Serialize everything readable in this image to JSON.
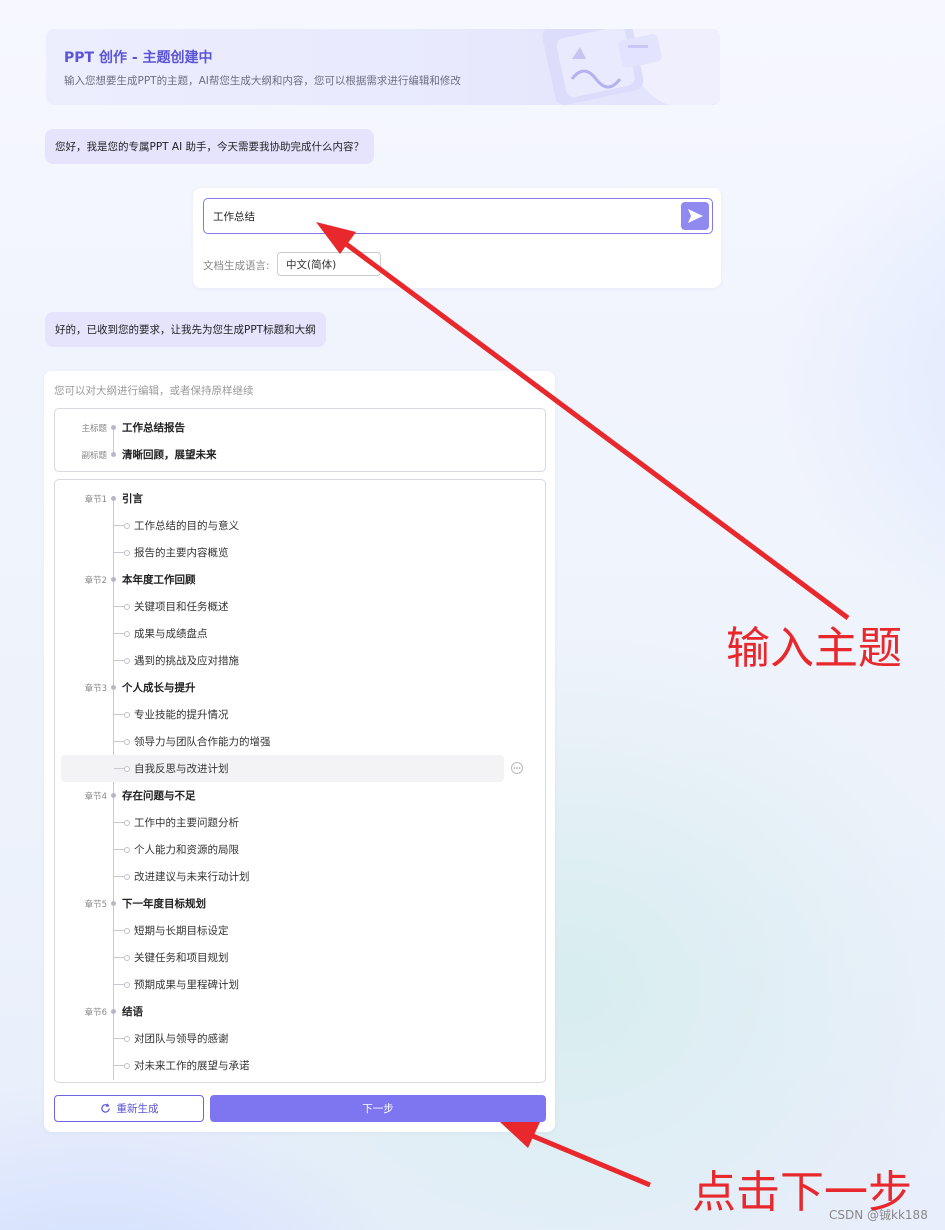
{
  "header": {
    "title": "PPT 创作 - 主题创建中",
    "subtitle": "输入您想要生成PPT的主题，AI帮您生成大纲和内容，您可以根据需求进行编辑和修改"
  },
  "chat": {
    "greeting": "您好，我是您的专属PPT AI 助手，今天需要我协助完成什么内容？",
    "ack": "好的，已收到您的要求，让我先为您生成PPT标题和大纲"
  },
  "input": {
    "topic_value": "工作总结",
    "language_label": "文档生成语言:",
    "language_value": "中文(简体)"
  },
  "outline": {
    "hint": "您可以对大纲进行编辑，或者保持原样继续",
    "main_title_tag": "主标题",
    "main_title": "工作总结报告",
    "subtitle_tag": "副标题",
    "subtitle": "清晰回顾，展望未来",
    "chapters": [
      {
        "tag": "章节1",
        "title": "引言",
        "items": [
          "工作总结的目的与意义",
          "报告的主要内容概览"
        ]
      },
      {
        "tag": "章节2",
        "title": "本年度工作回顾",
        "items": [
          "关键项目和任务概述",
          "成果与成绩盘点",
          "遇到的挑战及应对措施"
        ]
      },
      {
        "tag": "章节3",
        "title": "个人成长与提升",
        "items": [
          "专业技能的提升情况",
          "领导力与团队合作能力的增强",
          "自我反思与改进计划"
        ]
      },
      {
        "tag": "章节4",
        "title": "存在问题与不足",
        "items": [
          "工作中的主要问题分析",
          "个人能力和资源的局限",
          "改进建议与未来行动计划"
        ]
      },
      {
        "tag": "章节5",
        "title": "下一年度目标规划",
        "items": [
          "短期与长期目标设定",
          "关键任务和项目规划",
          "预期成果与里程碑计划"
        ]
      },
      {
        "tag": "章节6",
        "title": "结语",
        "items": [
          "对团队与领导的感谢",
          "对未来工作的展望与承诺"
        ]
      }
    ],
    "regenerate_label": "重新生成",
    "next_label": "下一步"
  },
  "annotations": {
    "input_topic": "输入主题",
    "click_next": "点击下一步"
  },
  "watermark": "CSDN @铖kk188",
  "colors": {
    "accent": "#7d76f0",
    "arrow": "#e8282c"
  }
}
